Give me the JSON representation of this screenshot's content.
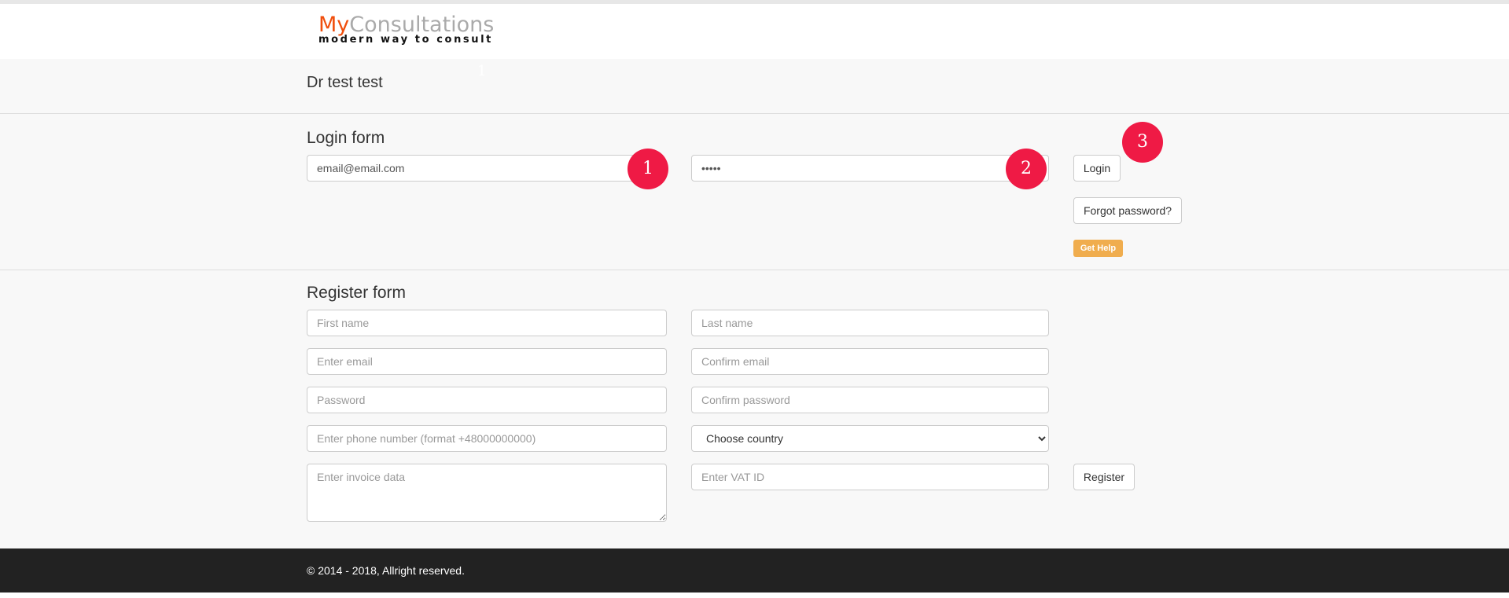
{
  "brand": {
    "my": "My",
    "rest": "Consultations",
    "tagline": "modern way to consult"
  },
  "user": {
    "name": "Dr test test",
    "ghost": "1"
  },
  "login": {
    "title": "Login form",
    "email_value": "email@email.com",
    "password_value": "•••••",
    "login_label": "Login",
    "forgot_label": "Forgot password?",
    "help_label": "Get Help"
  },
  "register": {
    "title": "Register form",
    "first_name": "First name",
    "last_name": "Last name",
    "email": "Enter email",
    "confirm_email": "Confirm email",
    "password": "Password",
    "confirm_password": "Confirm password",
    "phone": "Enter phone number (format +48000000000)",
    "country": "Choose country",
    "invoice": "Enter invoice data",
    "vat": "Enter VAT ID",
    "register_label": "Register"
  },
  "badges": [
    "1",
    "2",
    "3"
  ],
  "colors": {
    "badge": "#ef1a45",
    "help": "#f0ad4e",
    "brand": "#f04e0c"
  },
  "footer": {
    "text": "© 2014 - 2018, Allright reserved."
  }
}
